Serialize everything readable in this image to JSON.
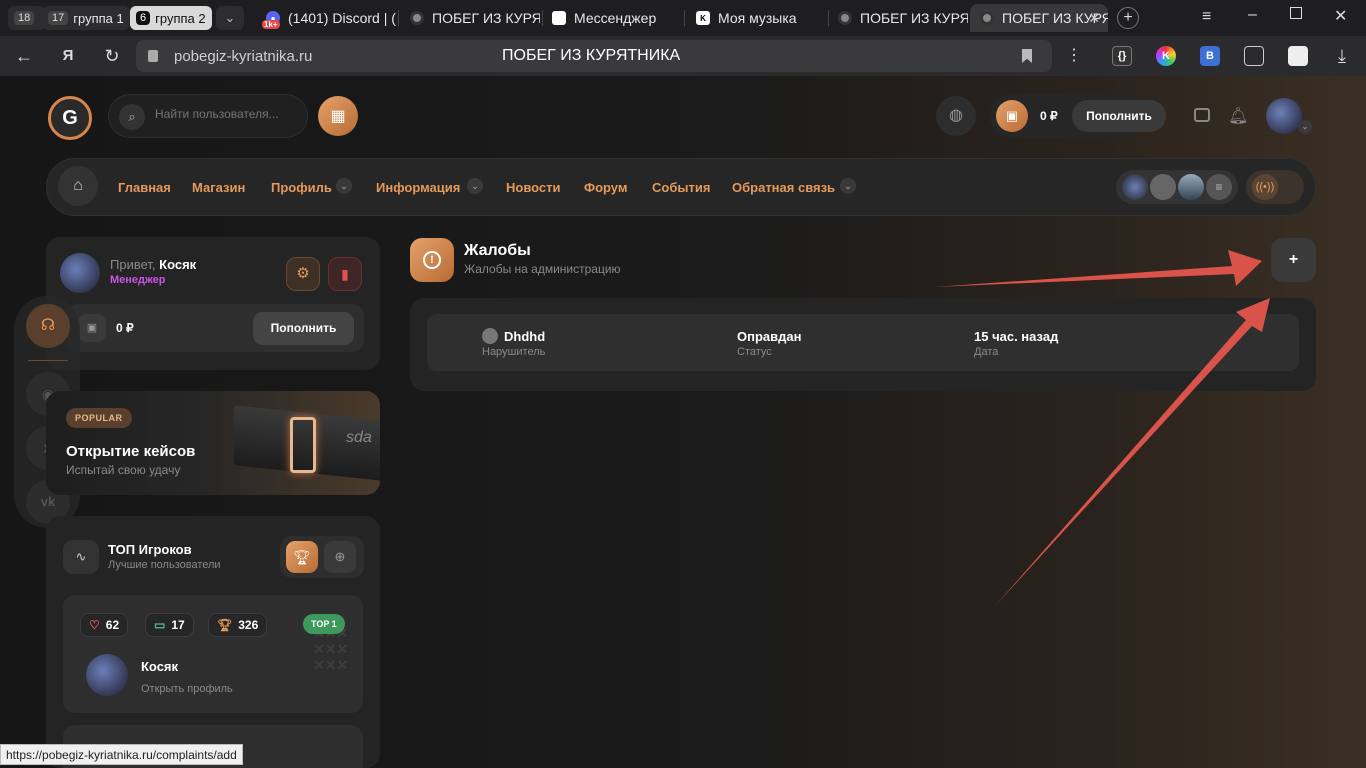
{
  "browser": {
    "groups": [
      {
        "count": "18",
        "label": ""
      },
      {
        "count": "17",
        "label": "группа 1"
      },
      {
        "count": "6",
        "label": "группа 2"
      }
    ],
    "tabs": [
      {
        "title": "(1401) Discord | (",
        "badge": "1k+"
      },
      {
        "title": "ПОБЕГ ИЗ КУРЯ"
      },
      {
        "title": "Мессенджер"
      },
      {
        "title": "Моя музыка"
      },
      {
        "title": "ПОБЕГ ИЗ КУРЯ"
      },
      {
        "title": "ПОБЕГ ИЗ КУРЯ"
      }
    ],
    "url": "pobegiz-kyriatnika.ru",
    "page_title": "ПОБЕГ ИЗ КУРЯТНИКА",
    "status_url": "https://pobegiz-kyriatnika.ru/complaints/add"
  },
  "header": {
    "search_placeholder": "Найти пользователя...",
    "balance": "0 ₽",
    "topup_label": "Пополнить"
  },
  "nav": {
    "items": [
      "Главная",
      "Магазин",
      "Профиль",
      "Информация",
      "Новости",
      "Форум",
      "События",
      "Обратная связь"
    ]
  },
  "sidebar": {
    "greeting": "Привет,",
    "username": "Косяк",
    "role": "Менеджер",
    "balance": "0 ₽",
    "topup_label": "Пополнить",
    "promo": {
      "badge": "POPULAR",
      "title": "Открытие кейсов",
      "subtitle": "Испытай свою удачу",
      "case_text": "sda"
    },
    "top": {
      "title": "ТОП Игроков",
      "subtitle": "Лучшие пользователи",
      "player": {
        "likes": "62",
        "comments": "17",
        "trophies": "326",
        "rank": "TOP 1",
        "name": "Косяк",
        "link": "Открыть профиль"
      }
    }
  },
  "main": {
    "title": "Жалобы",
    "subtitle": "Жалобы на администрацию",
    "add_label": "+",
    "complaints": [
      {
        "violator": "Dhdhd",
        "violator_label": "Нарушитель",
        "status": "Оправдан",
        "status_label": "Статус",
        "date": "15 час. назад",
        "date_label": "Дата"
      }
    ]
  },
  "colors": {
    "accent": "#e39a5c",
    "role": "#c855e8",
    "arrow": "#d9534a",
    "top_badge": "#3d9a5c"
  }
}
